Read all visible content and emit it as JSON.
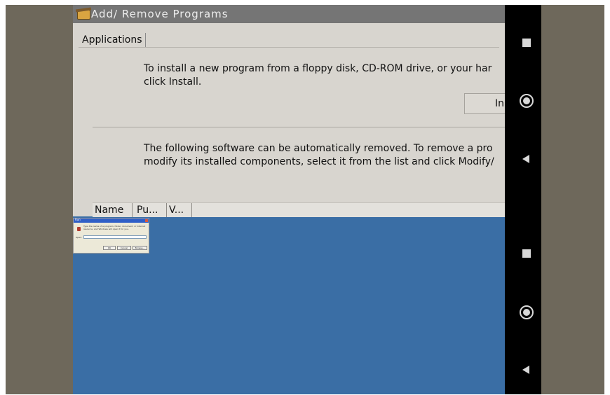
{
  "window": {
    "title": "Add/ Remove Programs",
    "tab_label": "Applications",
    "install_text_line1": "To install a new program from a floppy disk, CD-ROM drive, or your har",
    "install_text_line2": "click Install.",
    "install_button_label": "In",
    "remove_text_line1": "The following software can be automatically removed. To remove a pro",
    "remove_text_line2": "modify its installed components, select it from the list and click Modify/",
    "columns": [
      "Name",
      "Pu...",
      "V..."
    ]
  },
  "run_dialog": {
    "title": "Run",
    "text": "Type the name of a program, folder, document, or Internet resource, and Windows will open it for you.",
    "open_label": "Open:",
    "buttons": [
      "OK",
      "Cancel",
      "Browse..."
    ]
  },
  "navbar": {
    "icons": [
      "recent-apps-icon",
      "home-icon",
      "back-icon",
      "recent-apps-icon",
      "home-icon",
      "back-icon"
    ]
  },
  "colors": {
    "backdrop": "#6e685b",
    "desktop": "#3a6ea5",
    "window_bg": "#d8d5cf",
    "titlebar": "#757575",
    "navbar": "#000000"
  }
}
